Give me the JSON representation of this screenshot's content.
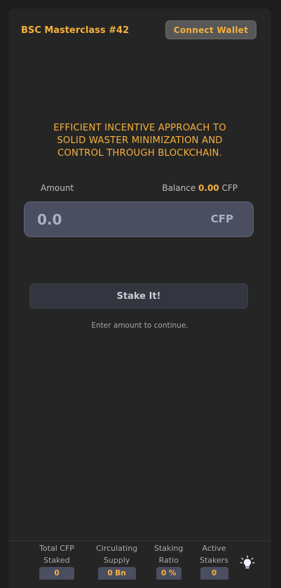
{
  "header": {
    "brand": "BSC Masterclass #42",
    "connect_label": "Connect Wallet"
  },
  "tagline": {
    "line1": "EFFICIENT INCENTIVE APPROACH TO",
    "line2": "SOLID WASTER MINIMIZATION AND",
    "line3": "CONTROL THROUGH BLOCKCHAIN."
  },
  "form": {
    "amount_label": "Amount",
    "balance_label": "Balance",
    "balance_value": "0.00",
    "balance_unit": "CFP",
    "amount_placeholder": "0.0",
    "amount_unit": "CFP",
    "stake_label": "Stake It!",
    "hint": "Enter amount to continue."
  },
  "stats": [
    {
      "line1": "Total CFP",
      "line2": "Staked",
      "value": "0"
    },
    {
      "line1": "Circulating",
      "line2": "Supply",
      "value": "0 Bn"
    },
    {
      "line1": "Staking",
      "line2": "Ratio",
      "value": "0 %"
    },
    {
      "line1": "Active",
      "line2": "Stakers",
      "value": "0"
    }
  ],
  "icons": {
    "theme_toggle": "lightbulb-icon"
  },
  "colors": {
    "accent": "#f5b13d",
    "input_bg": "#4b4e60",
    "panel_bg": "#252525"
  }
}
